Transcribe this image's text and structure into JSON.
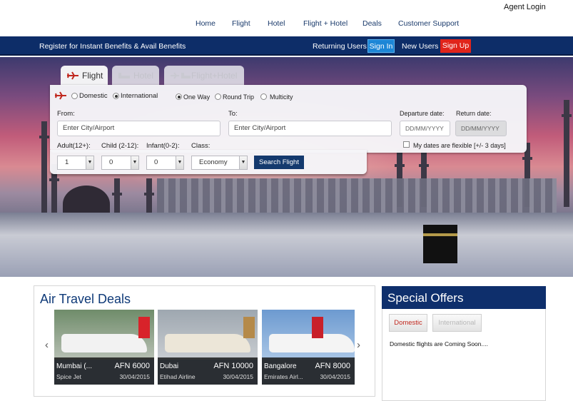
{
  "header": {
    "agent_login": "Agent Login",
    "nav": [
      {
        "label": "Home"
      },
      {
        "label": "Flight"
      },
      {
        "label": "Hotel"
      },
      {
        "label": "Flight + Hotel"
      },
      {
        "label": "Deals"
      },
      {
        "label": "Customer Support"
      }
    ]
  },
  "user_bar": {
    "promo": "Register for Instant Benefits & Avail Benefits",
    "returning_users": "Returning Users",
    "sign_in": "Sign In",
    "new_users": "New Users",
    "sign_up": "Sign Up"
  },
  "search": {
    "tabs": [
      {
        "label": "Flight",
        "icon": "plane-icon",
        "active": true
      },
      {
        "label": "Hotel",
        "icon": "bed-icon",
        "active": false
      },
      {
        "label": "Flight+Hotel",
        "icon": "plane-bed-icon",
        "active": false
      }
    ],
    "scope_options": [
      {
        "label": "Domestic",
        "selected": false
      },
      {
        "label": "International",
        "selected": true
      }
    ],
    "trip_options": [
      {
        "label": "One Way",
        "selected": true
      },
      {
        "label": "Round Trip",
        "selected": false
      },
      {
        "label": "Multicity",
        "selected": false
      }
    ],
    "from_label": "From:",
    "from_placeholder": "Enter City/Airport",
    "to_label": "To:",
    "to_placeholder": "Enter City/Airport",
    "departure_label": "Departure date:",
    "departure_placeholder": "DD/MM/YYYY",
    "return_label": "Return date:",
    "return_placeholder": "DD/MM/YYYY",
    "flexible_label": "My dates are flexible [+/- 3 days]",
    "adult_label": "Adult(12+):",
    "adult_value": "1",
    "child_label": "Child (2-12):",
    "child_value": "0",
    "infant_label": "Infant(0-2):",
    "infant_value": "0",
    "class_label": "Class:",
    "class_value": "Economy",
    "search_button": "Search Flight"
  },
  "deals": {
    "title": "Air Travel Deals",
    "prev": "‹",
    "next": "›",
    "items": [
      {
        "city": "Mumbai (...",
        "price": "AFN 6000",
        "airline": "Spice Jet",
        "date": "30/04/2015",
        "color": "#d8232a"
      },
      {
        "city": "Dubai",
        "price": "AFN 10000",
        "airline": "Etihad Airline",
        "date": "30/04/2015",
        "color": "#b58a4a"
      },
      {
        "city": "Bangalore",
        "price": "AFN 8000",
        "airline": "Emirates Airl...",
        "date": "30/04/2015",
        "color": "#c8202a"
      }
    ]
  },
  "offers": {
    "title": "Special Offers",
    "tabs": [
      {
        "label": "Domestic",
        "active": true
      },
      {
        "label": "International",
        "active": false
      }
    ],
    "message": "Domestic flights are Coming Soon...."
  }
}
